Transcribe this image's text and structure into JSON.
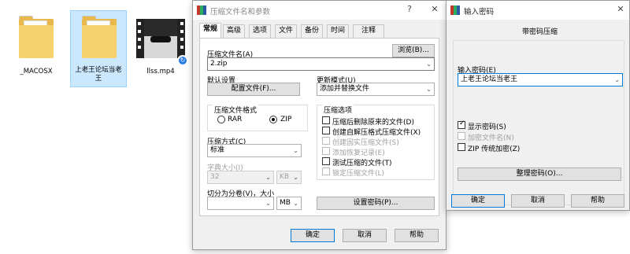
{
  "desktop": {
    "files": [
      {
        "name": "_MACOSX"
      },
      {
        "name": "上老王论坛当老王"
      },
      {
        "name": "llss.mp4"
      }
    ]
  },
  "main_dialog": {
    "title": "压缩文件名和参数",
    "help_btn": "?",
    "close_btn": "✕",
    "tabs": [
      "常规",
      "高级",
      "选项",
      "文件",
      "备份",
      "时间",
      "注释"
    ],
    "archive_name_label": "压缩文件名(A)",
    "archive_name_value": "2.zip",
    "browse_button": "浏览(B)...",
    "default_settings_label": "默认设置",
    "profiles_button": "配置文件(F)...",
    "update_mode_label": "更新模式(U)",
    "update_mode_value": "添加并替换文件",
    "format_group_label": "压缩文件格式",
    "format_rar": "RAR",
    "format_zip": "ZIP",
    "options_group_label": "压缩选项",
    "options": [
      {
        "label": "压缩后删除原来的文件(D)",
        "checked": false,
        "disabled": false
      },
      {
        "label": "创建自解压格式压缩文件(X)",
        "checked": false,
        "disabled": false
      },
      {
        "label": "创建固实压缩文件(S)",
        "checked": false,
        "disabled": true
      },
      {
        "label": "添加恢复记录(E)",
        "checked": false,
        "disabled": true
      },
      {
        "label": "测试压缩的文件(T)",
        "checked": false,
        "disabled": false
      },
      {
        "label": "锁定压缩文件(L)",
        "checked": false,
        "disabled": true
      }
    ],
    "method_label": "压缩方式(C)",
    "method_value": "标准",
    "dict_label": "字典大小(I)",
    "dict_value": "32",
    "dict_unit": "KB",
    "split_label": "切分为分卷(V)，大小",
    "split_unit": "MB",
    "set_password_button": "设置密码(P)...",
    "ok": "确定",
    "cancel": "取消",
    "help": "帮助"
  },
  "pwd_dialog": {
    "title": "输入密码",
    "close_btn": "✕",
    "header": "带密码压缩",
    "enter_label": "输入密码(E)",
    "password_value": "上老王论坛当老王",
    "show_password": {
      "label": "显示密码(S)",
      "checked": true
    },
    "encrypt_names": {
      "label": "加密文件名(N)",
      "checked": false,
      "disabled": true
    },
    "zip_legacy": {
      "label": "ZIP 传统加密(Z)",
      "checked": false
    },
    "organize_button": "整理密码(O)...",
    "ok": "确定",
    "cancel": "取消",
    "help": "帮助"
  }
}
